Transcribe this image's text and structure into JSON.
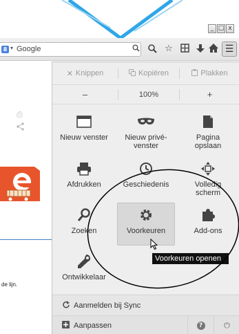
{
  "window": {
    "minimize_glyph": "_",
    "maximize_glyph": "□",
    "close_glyph": "x"
  },
  "toolbar": {
    "search_engine": "Google",
    "search_engine_letter": "8",
    "engine_dropdown_glyph": "▾",
    "search_go_icon": "magnifier-icon",
    "icons": [
      "search-icon",
      "star-icon",
      "reading-list-icon",
      "download-icon",
      "home-icon",
      "menu-icon"
    ]
  },
  "page": {
    "partial_text": "de lijn."
  },
  "menu": {
    "edit": {
      "cut": "Knippen",
      "copy": "Kopiëren",
      "paste": "Plakken"
    },
    "zoom": {
      "minus": "–",
      "level": "100%",
      "plus": "+"
    },
    "items": [
      {
        "label": "Nieuw venster",
        "icon": "new-window-icon"
      },
      {
        "label": "Nieuw privé-venster",
        "icon": "private-mask-icon"
      },
      {
        "label": "Pagina opslaan",
        "icon": "save-page-icon"
      },
      {
        "label": "Afdrukken",
        "icon": "printer-icon"
      },
      {
        "label": "Geschiedenis",
        "icon": "history-clock-icon"
      },
      {
        "label": "Volledig scherm",
        "icon": "fullscreen-icon"
      },
      {
        "label": "Zoeken",
        "icon": "find-icon"
      },
      {
        "label": "Voorkeuren",
        "icon": "gear-icon"
      },
      {
        "label": "Add-ons",
        "icon": "puzzle-icon"
      },
      {
        "label": "Ontwikkelaar",
        "icon": "wrench-icon"
      }
    ],
    "item_labels": {
      "new_window": "Nieuw venster",
      "new_private_1": "Nieuw privé-",
      "new_private_2": "venster",
      "save_1": "Pagina",
      "save_2": "opslaan",
      "print": "Afdrukken",
      "history": "Geschiedenis",
      "fullscreen_1": "Volledig",
      "fullscreen_2": "scherm",
      "find": "Zoeken",
      "preferences": "Voorkeuren",
      "addons": "Add-ons",
      "developer": "Ontwikkelaar"
    },
    "tooltip": "Voorkeuren openen",
    "sync": "Aanmelden bij Sync",
    "customize": "Aanpassen",
    "help_glyph": "?",
    "quit_glyph": "⏻"
  },
  "colors": {
    "panel_bg": "#eeeeee",
    "active_item_bg": "#d8d8d8",
    "tooltip_bg": "#111111",
    "link_blue": "#3d7fbf",
    "logo_orange": "#e8542b"
  }
}
